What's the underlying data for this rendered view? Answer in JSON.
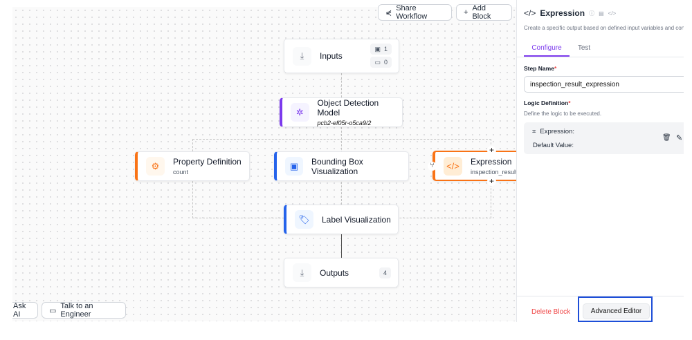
{
  "toolbar": {
    "share": "Share Workflow",
    "add": "Add Block"
  },
  "bottom": {
    "ask": "Ask AI",
    "talk": "Talk to an Engineer"
  },
  "nodes": {
    "inputs": {
      "title": "Inputs",
      "image_count": "1",
      "param_count": "0"
    },
    "detection": {
      "title": "Object Detection Model",
      "subtitle": "pcb2-ef05r-o5ca9/2",
      "color": "#7c3aed"
    },
    "property": {
      "title": "Property Definition",
      "subtitle": "count",
      "color": "#f97316"
    },
    "bbox": {
      "title": "Bounding Box Visualization",
      "color": "#2563eb"
    },
    "expression": {
      "title": "Expression",
      "subtitle": "inspection_result_expression",
      "color": "#f97316"
    },
    "label": {
      "title": "Label Visualization",
      "color": "#2563eb"
    },
    "outputs": {
      "title": "Outputs",
      "count": "4"
    }
  },
  "panel": {
    "title": "Expression",
    "description": "Create a specific output based on defined input variables and configured rules.",
    "tabs": [
      {
        "label": "Configure",
        "active": true
      },
      {
        "label": "Test",
        "active": false
      }
    ],
    "step_name_label": "Step Name",
    "step_name_value": "inspection_result_expression",
    "logic_label": "Logic Definition",
    "logic_help": "Define the logic to be executed.",
    "expression_label": "Expression:",
    "default_label": "Default Value:",
    "delete": "Delete Block",
    "advanced": "Advanced Editor",
    "accent": "#7c3aed"
  }
}
